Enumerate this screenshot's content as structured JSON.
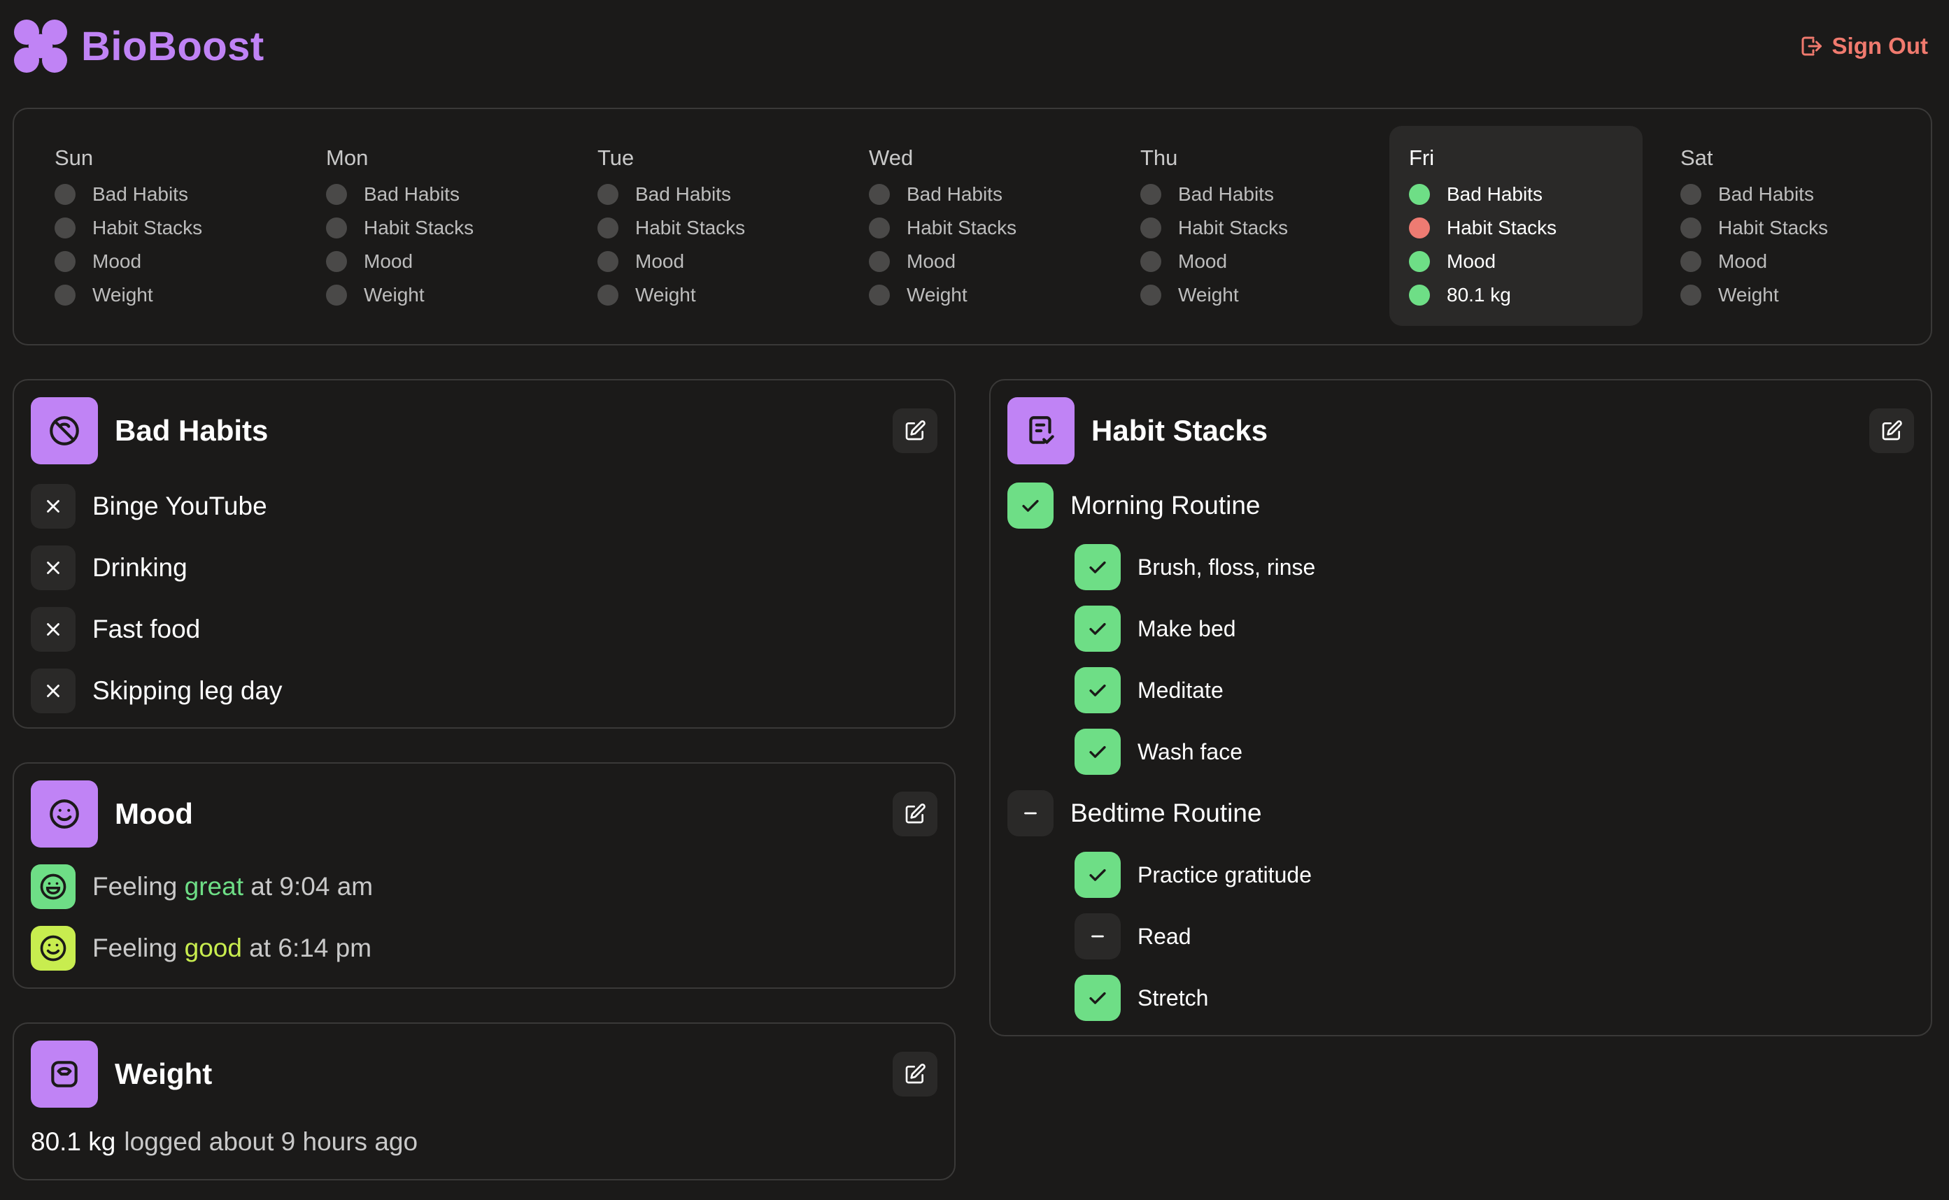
{
  "app": {
    "name": "BioBoost",
    "sign_out": "Sign Out"
  },
  "week": [
    {
      "day": "Sun",
      "active": false,
      "items": [
        {
          "label": "Bad Habits",
          "status": "none"
        },
        {
          "label": "Habit Stacks",
          "status": "none"
        },
        {
          "label": "Mood",
          "status": "none"
        },
        {
          "label": "Weight",
          "status": "none"
        }
      ]
    },
    {
      "day": "Mon",
      "active": false,
      "items": [
        {
          "label": "Bad Habits",
          "status": "none"
        },
        {
          "label": "Habit Stacks",
          "status": "none"
        },
        {
          "label": "Mood",
          "status": "none"
        },
        {
          "label": "Weight",
          "status": "none"
        }
      ]
    },
    {
      "day": "Tue",
      "active": false,
      "items": [
        {
          "label": "Bad Habits",
          "status": "none"
        },
        {
          "label": "Habit Stacks",
          "status": "none"
        },
        {
          "label": "Mood",
          "status": "none"
        },
        {
          "label": "Weight",
          "status": "none"
        }
      ]
    },
    {
      "day": "Wed",
      "active": false,
      "items": [
        {
          "label": "Bad Habits",
          "status": "none"
        },
        {
          "label": "Habit Stacks",
          "status": "none"
        },
        {
          "label": "Mood",
          "status": "none"
        },
        {
          "label": "Weight",
          "status": "none"
        }
      ]
    },
    {
      "day": "Thu",
      "active": false,
      "items": [
        {
          "label": "Bad Habits",
          "status": "none"
        },
        {
          "label": "Habit Stacks",
          "status": "none"
        },
        {
          "label": "Mood",
          "status": "none"
        },
        {
          "label": "Weight",
          "status": "none"
        }
      ]
    },
    {
      "day": "Fri",
      "active": true,
      "items": [
        {
          "label": "Bad Habits",
          "status": "green"
        },
        {
          "label": "Habit Stacks",
          "status": "red"
        },
        {
          "label": "Mood",
          "status": "green"
        },
        {
          "label": "80.1 kg",
          "status": "green"
        }
      ]
    },
    {
      "day": "Sat",
      "active": false,
      "items": [
        {
          "label": "Bad Habits",
          "status": "none"
        },
        {
          "label": "Habit Stacks",
          "status": "none"
        },
        {
          "label": "Mood",
          "status": "none"
        },
        {
          "label": "Weight",
          "status": "none"
        }
      ]
    }
  ],
  "bad_habits": {
    "title": "Bad Habits",
    "items": [
      "Binge YouTube",
      "Drinking",
      "Fast food",
      "Skipping leg day"
    ]
  },
  "mood": {
    "title": "Mood",
    "entries": [
      {
        "prefix": "Feeling",
        "mood": "great",
        "suffix": "at 9:04 am",
        "color": "#6ede86"
      },
      {
        "prefix": "Feeling",
        "mood": "good",
        "suffix": "at 6:14 pm",
        "color": "#c8ed4f"
      }
    ]
  },
  "weight": {
    "title": "Weight",
    "value": "80.1 kg",
    "note": "logged about 9 hours ago"
  },
  "habit_stacks": {
    "title": "Habit Stacks",
    "stacks": [
      {
        "name": "Morning Routine",
        "done": true,
        "items": [
          {
            "label": "Brush, floss, rinse",
            "done": true
          },
          {
            "label": "Make bed",
            "done": true
          },
          {
            "label": "Meditate",
            "done": true
          },
          {
            "label": "Wash face",
            "done": true
          }
        ]
      },
      {
        "name": "Bedtime Routine",
        "done": false,
        "items": [
          {
            "label": "Practice gratitude",
            "done": true
          },
          {
            "label": "Read",
            "done": false
          },
          {
            "label": "Stretch",
            "done": true
          }
        ]
      }
    ]
  },
  "colors": {
    "accent": "#c083f5",
    "success": "#6ede86",
    "danger": "#ee7b72",
    "signout": "#f07a6e",
    "background": "#1b1a19"
  }
}
